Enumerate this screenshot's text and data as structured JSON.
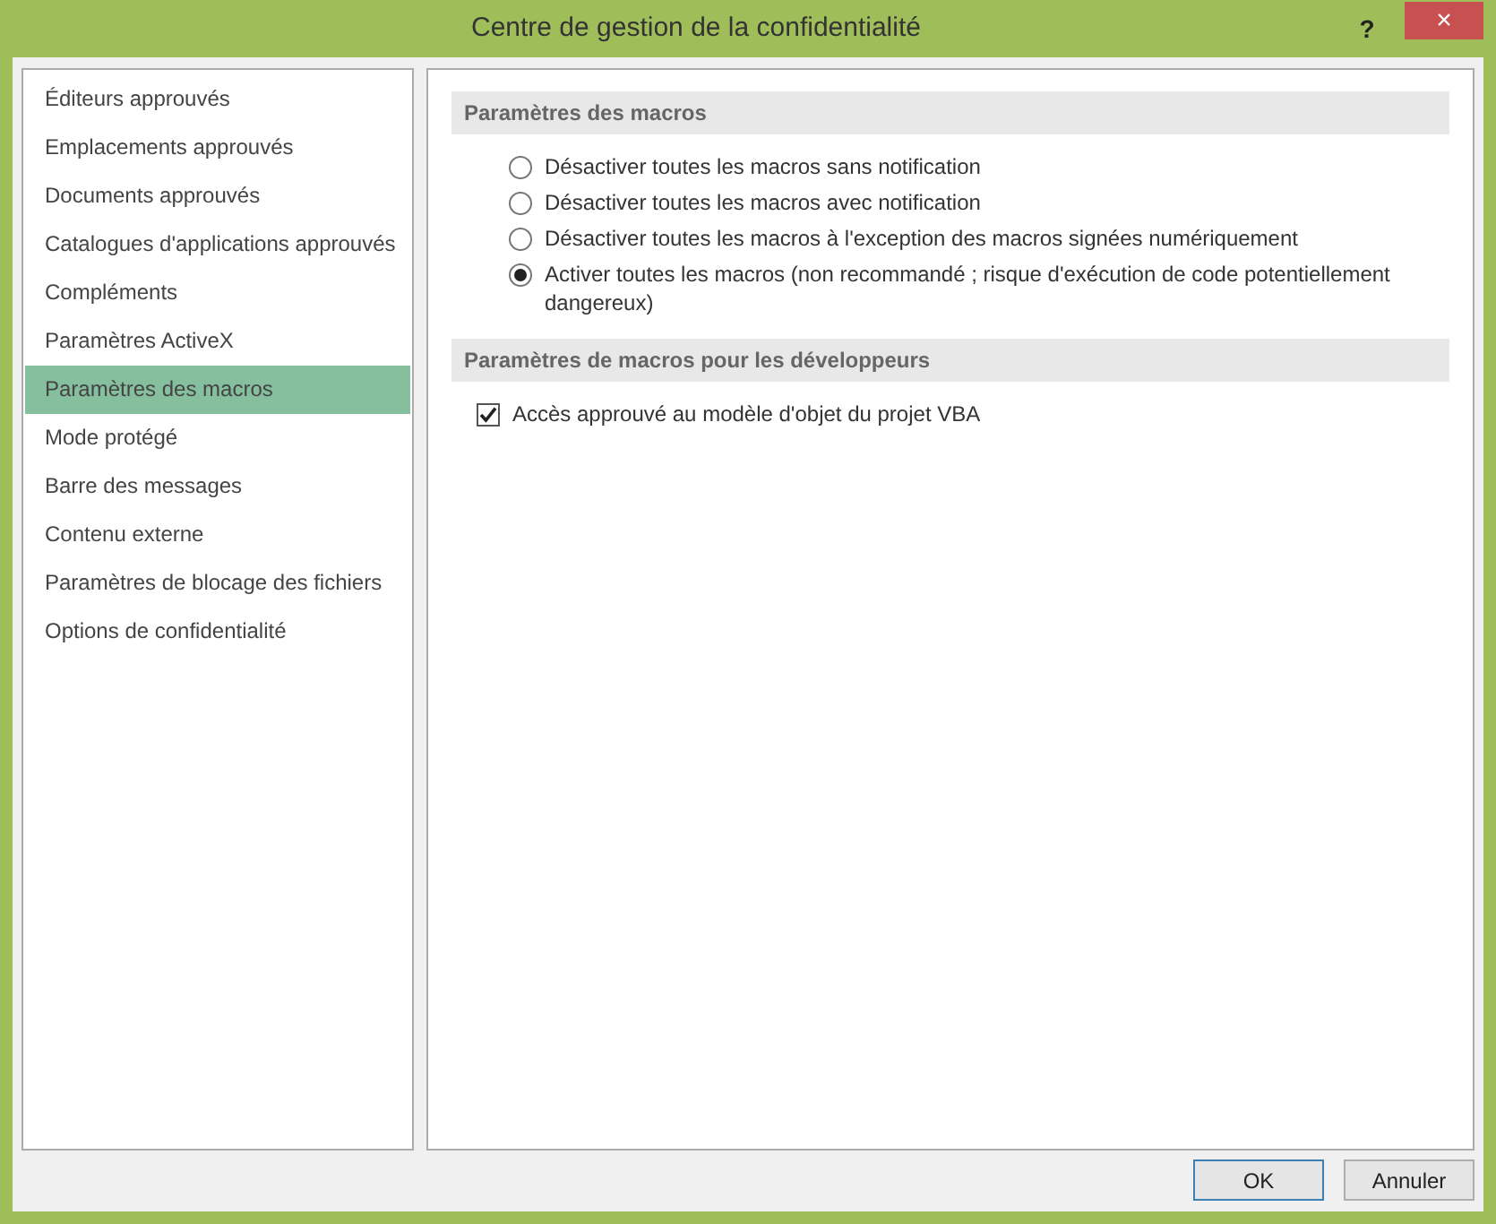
{
  "window": {
    "title": "Centre de gestion de la confidentialité",
    "help": "?",
    "close": "×"
  },
  "sidebar": {
    "items": [
      {
        "label": "Éditeurs approuvés",
        "selected": false
      },
      {
        "label": "Emplacements approuvés",
        "selected": false
      },
      {
        "label": "Documents approuvés",
        "selected": false
      },
      {
        "label": "Catalogues d'applications approuvés",
        "selected": false
      },
      {
        "label": "Compléments",
        "selected": false
      },
      {
        "label": "Paramètres ActiveX",
        "selected": false
      },
      {
        "label": "Paramètres des macros",
        "selected": true
      },
      {
        "label": "Mode protégé",
        "selected": false
      },
      {
        "label": "Barre des messages",
        "selected": false
      },
      {
        "label": "Contenu externe",
        "selected": false
      },
      {
        "label": "Paramètres de blocage des fichiers",
        "selected": false
      },
      {
        "label": "Options de confidentialité",
        "selected": false
      }
    ]
  },
  "sections": [
    {
      "heading": "Paramètres des macros",
      "options": [
        {
          "kind": "radio",
          "label": "Désactiver toutes les macros sans notification",
          "selected": false
        },
        {
          "kind": "radio",
          "label": "Désactiver toutes les macros avec notification",
          "selected": false
        },
        {
          "kind": "radio",
          "label": "Désactiver toutes les macros à l'exception des macros signées numériquement",
          "selected": false
        },
        {
          "kind": "radio",
          "label": "Activer toutes les macros (non recommandé ; risque d'exécution de code potentiellement dangereux)",
          "selected": true
        }
      ]
    },
    {
      "heading": "Paramètres de macros pour les développeurs",
      "options": [
        {
          "kind": "checkbox",
          "label": "Accès approuvé au modèle d'objet du projet VBA",
          "checked": true
        }
      ]
    }
  ],
  "buttons": [
    {
      "label": "OK",
      "default": true
    },
    {
      "label": "Annuler",
      "default": false
    }
  ]
}
